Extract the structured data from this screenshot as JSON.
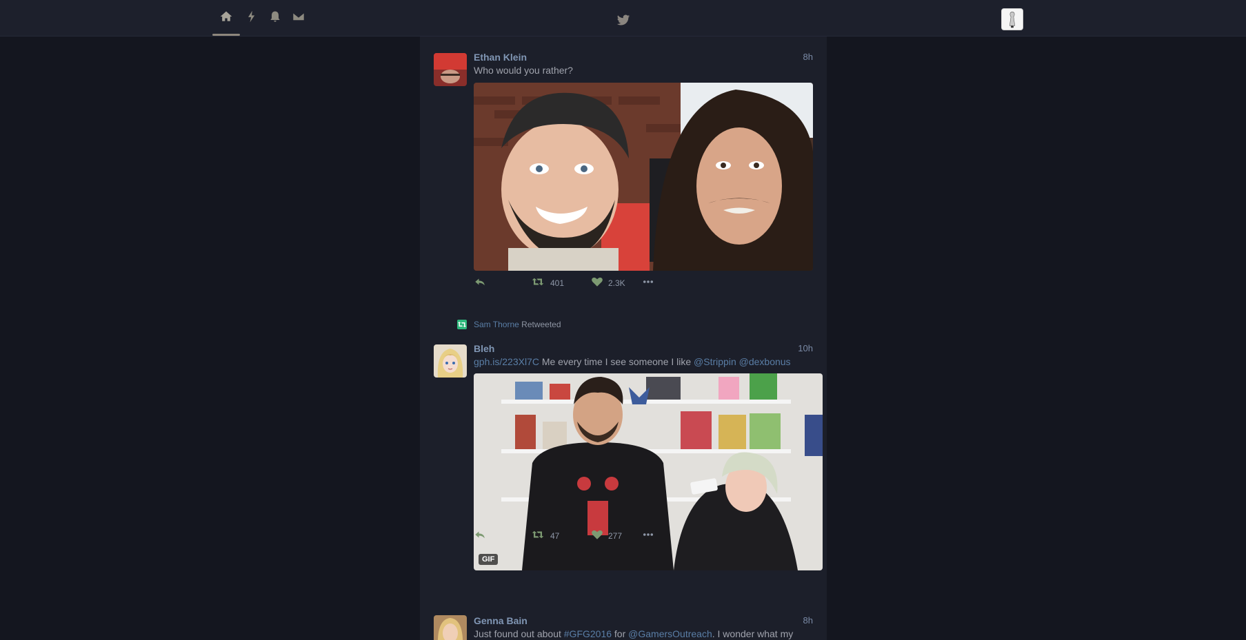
{
  "nav": {
    "items": [
      {
        "name": "home-icon",
        "active": true
      },
      {
        "name": "moments-icon",
        "active": false
      },
      {
        "name": "notifications-icon",
        "active": false
      },
      {
        "name": "messages-icon",
        "active": false
      }
    ]
  },
  "tweets": [
    {
      "author": "Ethan Klein",
      "time": "8h",
      "text": "Who would you rather?",
      "retweets": "401",
      "likes": "2.3K"
    },
    {
      "retweeted_by": "Sam Thorne",
      "retweeted_label": "Retweeted",
      "author": "Bleh",
      "time": "10h",
      "text_link": "gph.is/223Xl7C",
      "text_mid": " Me every time I see someone I like ",
      "mention1": "@Strippin",
      "mention2": "@dexbonus",
      "gif_label": "GIF",
      "retweets": "47",
      "likes": "277"
    },
    {
      "author": "Genna Bain",
      "time": "8h",
      "text_start": "Just found out about ",
      "hashtag": "#GFG2016",
      "text_mid": " for ",
      "mention": "@GamersOutreach",
      "text_end": ". I wonder what my"
    }
  ],
  "colors": {
    "background": "#14161f",
    "topbar": "#1d202c",
    "timeline": "#1c1f2a",
    "author": "#8096b4",
    "link": "#5a7ea6",
    "action": "#7d9a72",
    "retweet_badge": "#2eb87c"
  }
}
